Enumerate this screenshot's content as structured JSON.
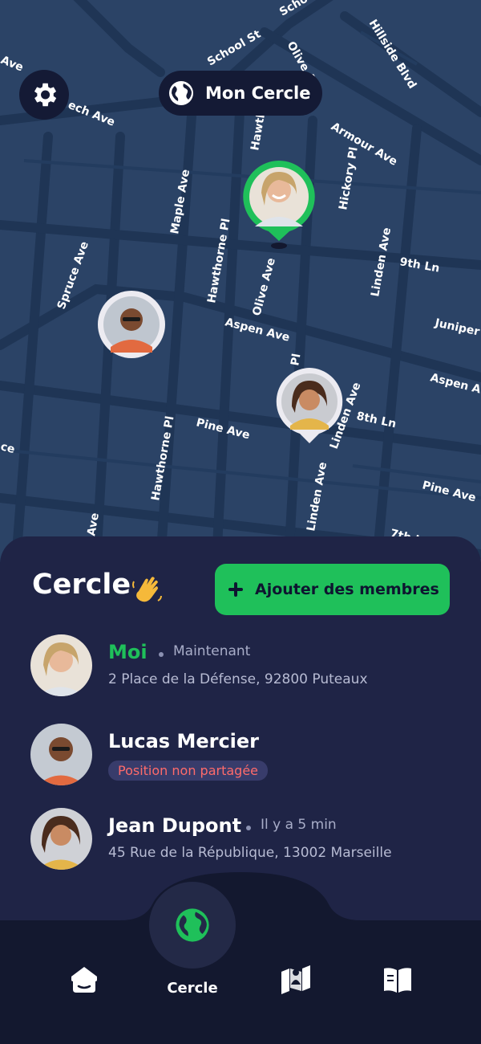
{
  "header": {
    "settings_icon": "gear-icon",
    "circle_title": "Mon Cercle",
    "circle_icon": "globe-icon"
  },
  "map": {
    "streets": {
      "school_st": "School St",
      "school_top": "School",
      "olive_top": "Olive A",
      "hillside": "Hillside Blvd",
      "armour": "Armour Ave",
      "beech": "ech Ave",
      "ave_left": "Ave",
      "hawth_top": "Hawth",
      "hickory": "Hickory Pl",
      "maple": "Maple Ave",
      "spruce": "Spruce Ave",
      "hawthorne_1": "Hawthorne Pl",
      "olive_ave": "Olive Ave",
      "linden_1": "Linden Ave",
      "ninth": "9th Ln",
      "juniper": "Juniper A",
      "aspen_1": "Aspen Ave",
      "aspen_2": "Aspen Ave",
      "pl": "Pl",
      "eighth": "8th Ln",
      "linden_2": "Linden Ave",
      "pine_1": "Pine Ave",
      "pine_2": "Pine Ave",
      "hawthorne_2": "Hawthorne Pl",
      "linden_3": "Linden Ave",
      "ave_bottom": "Ave",
      "ce": "ce",
      "seventh": "7th L"
    },
    "colors": {
      "background": "#2b4366",
      "roads": "#223a5c",
      "self_pin": "#1fc05a"
    }
  },
  "sheet": {
    "title": "Cercle",
    "wave_icon": "waving-hand-icon",
    "add_button": {
      "label": "Ajouter des membres",
      "icon": "plus-icon"
    },
    "members": [
      {
        "name": "Moi",
        "time": "Maintenant",
        "address": "2 Place de la Défense, 92800 Puteaux",
        "highlight": "#1fc05a"
      },
      {
        "name": "Lucas Mercier",
        "badge": "Position non partagée"
      },
      {
        "name": "Jean Dupont",
        "time": "Il y a 5 min",
        "address": "45 Rue de la République, 13002 Marseille"
      }
    ]
  },
  "nav": {
    "active_label": "Cercle",
    "items": [
      "home-icon",
      "globe-icon",
      "map-person-icon",
      "book-icon"
    ]
  }
}
